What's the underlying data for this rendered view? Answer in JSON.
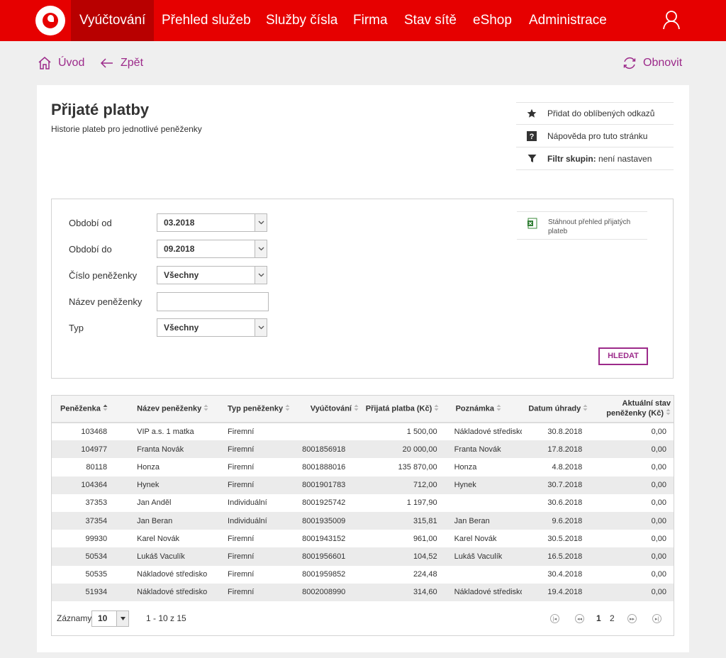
{
  "nav": {
    "items": [
      "Vyúčtování",
      "Přehled služeb",
      "Služby čísla",
      "Firma",
      "Stav sítě",
      "eShop",
      "Administrace"
    ],
    "active_index": 0
  },
  "subbar": {
    "home": "Úvod",
    "back": "Zpět",
    "refresh": "Obnovit"
  },
  "page": {
    "title": "Přijaté platby",
    "subtitle": "Historie plateb pro jednotlivé peněženky"
  },
  "side_links": {
    "favorite": "Přidat do oblíbených odkazů",
    "help": "Nápověda pro tuto stránku",
    "filter_label": "Filtr skupin:",
    "filter_value": "není nastaven"
  },
  "filter": {
    "period_from_label": "Období od",
    "period_from_value": "03.2018",
    "period_to_label": "Období do",
    "period_to_value": "09.2018",
    "wallet_number_label": "Číslo peněženky",
    "wallet_number_value": "Všechny",
    "wallet_name_label": "Název peněženky",
    "wallet_name_value": "",
    "type_label": "Typ",
    "type_value": "Všechny",
    "download_label": "Stáhnout přehled přijatých plateb",
    "search_button": "HLEDAT"
  },
  "table": {
    "columns": [
      "Peněženka",
      "Název peněženky",
      "Typ peněženky",
      "Vyúčtování",
      "Přijatá platba (Kč)",
      "Poznámka",
      "Datum úhrady",
      "Aktuální stav peněženky (Kč)"
    ],
    "rows": [
      [
        "103468",
        "VIP a.s. 1 matka",
        "Firemní",
        "",
        "1 500,00",
        "Nákladové středisko",
        "30.8.2018",
        "0,00"
      ],
      [
        "104977",
        "Franta Novák",
        "Firemní",
        "8001856918",
        "20 000,00",
        "Franta Novák",
        "17.8.2018",
        "0,00"
      ],
      [
        "80118",
        "Honza",
        "Firemní",
        "8001888016",
        "135 870,00",
        "Honza",
        "4.8.2018",
        "0,00"
      ],
      [
        "104364",
        "Hynek",
        "Firemní",
        "8001901783",
        "712,00",
        "Hynek",
        "30.7.2018",
        "0,00"
      ],
      [
        "37353",
        "Jan Anděl",
        "Individuální",
        "8001925742",
        "1 197,90",
        "",
        "30.6.2018",
        "0,00"
      ],
      [
        "37354",
        "Jan Beran",
        "Individuální",
        "8001935009",
        "315,81",
        "Jan Beran",
        "9.6.2018",
        "0,00"
      ],
      [
        "99930",
        "Karel Novák",
        "Firemní",
        "8001943152",
        "961,00",
        "Karel Novák",
        "30.5.2018",
        "0,00"
      ],
      [
        "50534",
        "Lukáš Vaculík",
        "Firemní",
        "8001956601",
        "104,52",
        "Lukáš Vaculík",
        "16.5.2018",
        "0,00"
      ],
      [
        "50535",
        "Nákladové středisko I",
        "Firemní",
        "8001959852",
        "224,48",
        "",
        "30.4.2018",
        "0,00"
      ],
      [
        "51934",
        "Nákladové středisko II",
        "Firemní",
        "8002008990",
        "314,60",
        "Nákladové středisko II",
        "19.4.2018",
        "0,00"
      ]
    ]
  },
  "footer": {
    "records_label": "Záznamy",
    "records_value": "10",
    "range_text": "1 - 10 z 15",
    "pages": [
      "1",
      "2"
    ],
    "current_page": "1"
  },
  "colors": {
    "brand": "#e60000",
    "brand_dark": "#b80000",
    "accent": "#9c2a8a"
  },
  "icons": [
    "home-icon",
    "back-arrow-icon",
    "refresh-icon",
    "user-icon",
    "star-icon",
    "help-icon",
    "filter-icon",
    "excel-icon",
    "sort-icon",
    "first-page-icon",
    "prev-page-icon",
    "next-page-icon",
    "last-page-icon"
  ]
}
